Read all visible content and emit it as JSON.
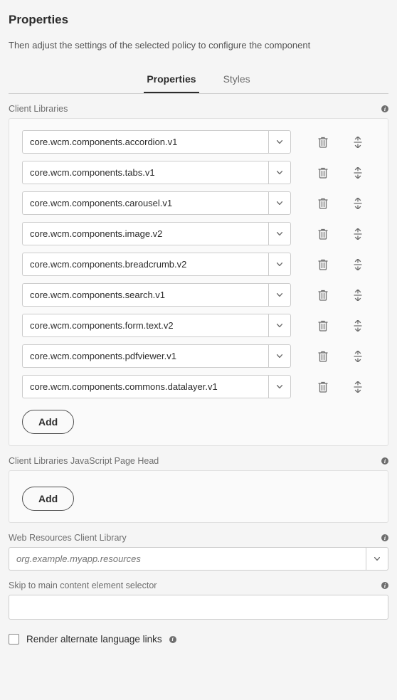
{
  "page": {
    "title": "Properties",
    "subtitle": "Then adjust the settings of the selected policy to configure the component"
  },
  "tabs": {
    "properties": "Properties",
    "styles": "Styles"
  },
  "sections": {
    "clientLibraries": {
      "label": "Client Libraries",
      "items": [
        {
          "value": "core.wcm.components.accordion.v1"
        },
        {
          "value": "core.wcm.components.tabs.v1"
        },
        {
          "value": "core.wcm.components.carousel.v1"
        },
        {
          "value": "core.wcm.components.image.v2"
        },
        {
          "value": "core.wcm.components.breadcrumb.v2"
        },
        {
          "value": "core.wcm.components.search.v1"
        },
        {
          "value": "core.wcm.components.form.text.v2"
        },
        {
          "value": "core.wcm.components.pdfviewer.v1"
        },
        {
          "value": "core.wcm.components.commons.datalayer.v1"
        }
      ],
      "addLabel": "Add"
    },
    "jsPageHead": {
      "label": "Client Libraries JavaScript Page Head",
      "addLabel": "Add"
    },
    "webResources": {
      "label": "Web Resources Client Library",
      "placeholder": "org.example.myapp.resources"
    },
    "skipSelector": {
      "label": "Skip to main content element selector",
      "value": ""
    },
    "altLang": {
      "label": "Render alternate language links"
    }
  }
}
